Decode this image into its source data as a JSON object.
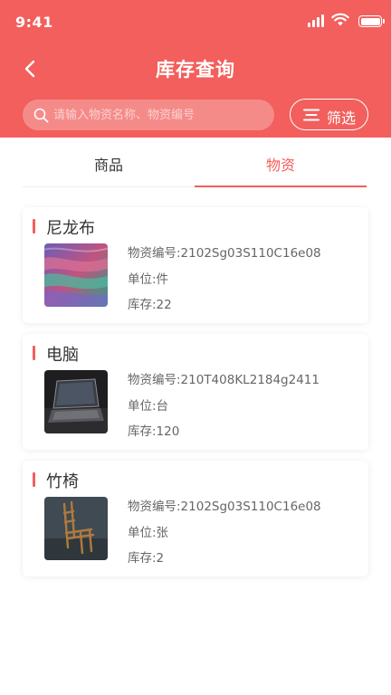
{
  "status_bar": {
    "time": "9:41"
  },
  "nav": {
    "title": "库存查询"
  },
  "search": {
    "placeholder": "请输入物资名称、物资编号"
  },
  "filter": {
    "label": "筛选"
  },
  "tabs": [
    {
      "label": "商品",
      "active": false
    },
    {
      "label": "物资",
      "active": true
    }
  ],
  "items": [
    {
      "name": "尼龙布",
      "code": "物资编号:2102Sg03S110C16e08",
      "unit": "单位:件",
      "stock": "库存:22"
    },
    {
      "name": "电脑",
      "code": "物资编号:210T408KL2184g2411",
      "unit": "单位:台",
      "stock": "库存:120"
    },
    {
      "name": "竹椅",
      "code": "物资编号:2102Sg03S110C16e08",
      "unit": "单位:张",
      "stock": "库存:2"
    }
  ],
  "colors": {
    "accent": "#f25f5c",
    "text": "#333333",
    "muted": "#666666"
  },
  "icons": [
    "back-arrow-icon",
    "search-icon",
    "filter-icon",
    "signal-icon",
    "wifi-icon",
    "battery-icon"
  ]
}
